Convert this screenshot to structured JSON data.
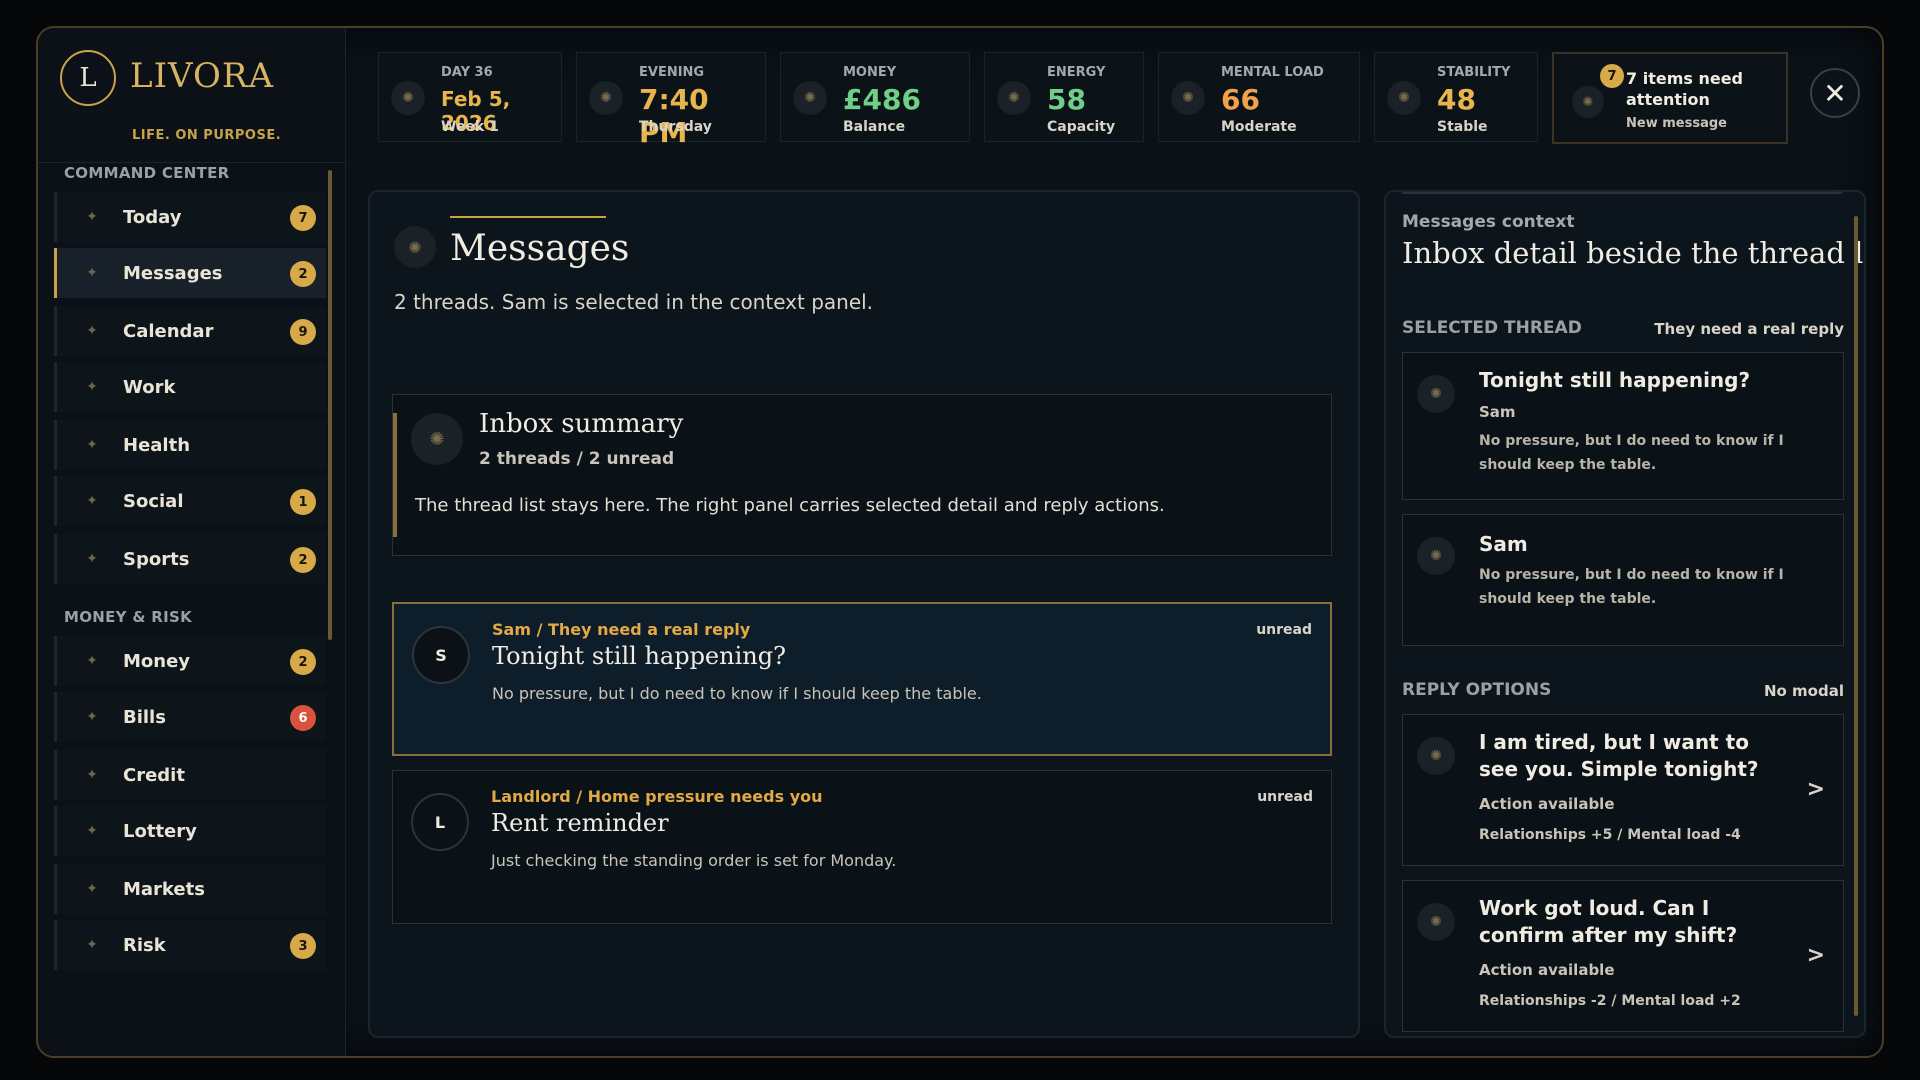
{
  "brand": {
    "badge": "L",
    "name": "LIVORA",
    "tagline": "LIFE. ON PURPOSE."
  },
  "sidebar": {
    "sections": [
      {
        "title": "COMMAND CENTER"
      },
      {
        "title": "MONEY & RISK"
      }
    ],
    "items": [
      {
        "label": "Today",
        "badge": "7"
      },
      {
        "label": "Messages",
        "badge": "2"
      },
      {
        "label": "Calendar",
        "badge": "9"
      },
      {
        "label": "Work",
        "badge": ""
      },
      {
        "label": "Health",
        "badge": ""
      },
      {
        "label": "Social",
        "badge": "1"
      },
      {
        "label": "Sports",
        "badge": "2"
      },
      {
        "label": "Money",
        "badge": "2"
      },
      {
        "label": "Bills",
        "badge": "6"
      },
      {
        "label": "Credit",
        "badge": ""
      },
      {
        "label": "Lottery",
        "badge": ""
      },
      {
        "label": "Markets",
        "badge": ""
      },
      {
        "label": "Risk",
        "badge": "3"
      }
    ]
  },
  "stats": {
    "day": {
      "label": "DAY 36",
      "value": "Feb 5, 2026",
      "sub": "Week 1"
    },
    "time": {
      "label": "EVENING",
      "value": "7:40 PM",
      "sub": "Thursday"
    },
    "money": {
      "label": "MONEY",
      "value": "£486",
      "sub": "Balance"
    },
    "energy": {
      "label": "ENERGY",
      "value": "58",
      "sub": "Capacity"
    },
    "mental": {
      "label": "MENTAL LOAD",
      "value": "66",
      "sub": "Moderate"
    },
    "stability": {
      "label": "STABILITY",
      "value": "48",
      "sub": "Stable"
    }
  },
  "alert": {
    "count": "7",
    "title": "7 items need attention",
    "sub": "New message"
  },
  "close_label": "✕",
  "colors": {
    "accent": "#c9a24c",
    "gold": "#e8b44e",
    "green": "#6fcf87",
    "orange": "#f0a14a",
    "danger": "#d9533c"
  },
  "main": {
    "title": "Messages",
    "subtitle": "2 threads. Sam is selected in the context panel.",
    "summary": {
      "title": "Inbox summary",
      "meta": "2 threads / 2 unread",
      "body": "The thread list stays here. The right panel carries selected detail and reply actions."
    },
    "threads": [
      {
        "avatar": "S",
        "meta": "Sam / They need a real reply",
        "status": "unread",
        "title": "Tonight still happening?",
        "body": "No pressure, but I do need to know if I should keep the table."
      },
      {
        "avatar": "L",
        "meta": "Landlord / Home pressure needs you",
        "status": "unread",
        "title": "Rent reminder",
        "body": "Just checking the standing order is set for Monday."
      }
    ]
  },
  "context": {
    "kicker": "Messages context",
    "title": "Inbox detail beside the thread list.",
    "selected_section": "SELECTED THREAD",
    "selected_note": "They need a real reply",
    "selected_card": {
      "title": "Tonight still happening?",
      "sub": "Sam",
      "body": "No pressure, but I do need to know if I should keep the table."
    },
    "message_card": {
      "title": "Sam",
      "body": "No pressure, but I do need to know if I should keep the table."
    },
    "reply_section": "REPLY OPTIONS",
    "reply_note": "No modal",
    "replies": [
      {
        "title": "I am tired, but I want to see you. Simple tonight?",
        "sub": "Action available",
        "effects": "Relationships +5 / Mental load -4",
        "arrow": ">"
      },
      {
        "title": "Work got loud. Can I confirm after my shift?",
        "sub": "Action available",
        "effects": "Relationships -2 / Mental load +2",
        "arrow": ">"
      }
    ]
  }
}
